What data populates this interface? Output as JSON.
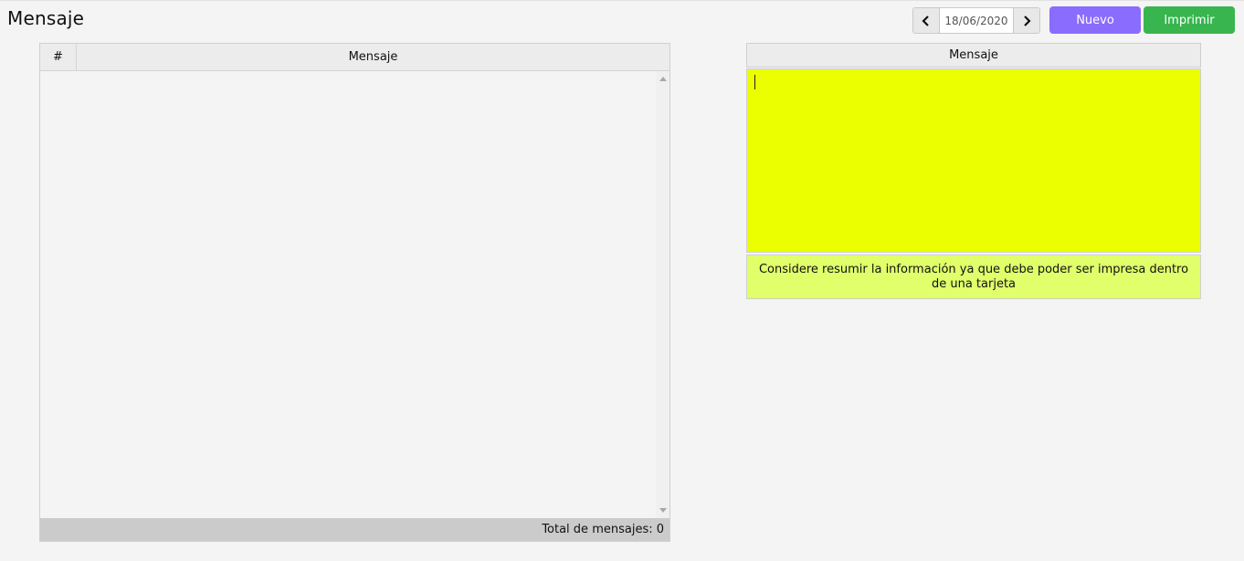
{
  "header": {
    "title": "Mensaje",
    "date": "18/06/2020",
    "nuevo_label": "Nuevo",
    "imprimir_label": "Imprimir"
  },
  "list": {
    "col_num": "#",
    "col_msg": "Mensaje",
    "footer": "Total de mensajes: 0"
  },
  "editor": {
    "header": "Mensaje",
    "value": "",
    "hint": "Considere resumir la información ya que debe poder ser impresa dentro de una tarjeta"
  },
  "colors": {
    "nuevo": "#8a6cff",
    "imprimir": "#38b54f",
    "editor_bg": "#ebff00",
    "hint_bg": "#e0ff6a"
  }
}
